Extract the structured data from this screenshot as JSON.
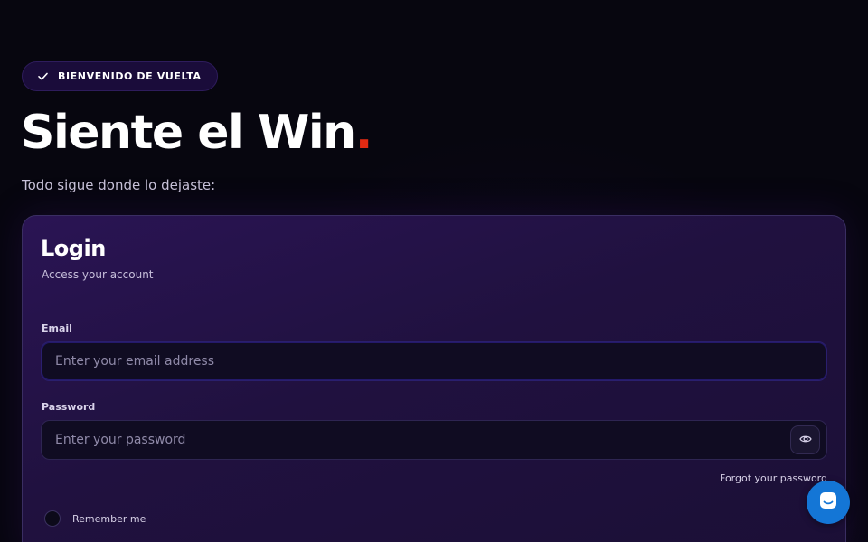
{
  "hero": {
    "badge_label": "BIENVENIDO DE VUELTA",
    "title": "Siente el Win",
    "title_dot": ".",
    "subtitle": "Todo sigue donde lo dejaste:"
  },
  "login": {
    "title": "Login",
    "subtitle": "Access your account",
    "email_label": "Email",
    "email_placeholder": "Enter your email address",
    "password_label": "Password",
    "password_placeholder": "Enter your password",
    "forgot_label": "Forgot your password",
    "remember_label": "Remember me"
  },
  "icons": {
    "badge": "check-icon",
    "password_toggle": "eye-icon",
    "chat": "chat-icon"
  },
  "colors": {
    "accent_dot": "#e12a12",
    "chat_button": "#1476d6",
    "card_bg": "#2a1454",
    "page_bg": "#07060f"
  }
}
